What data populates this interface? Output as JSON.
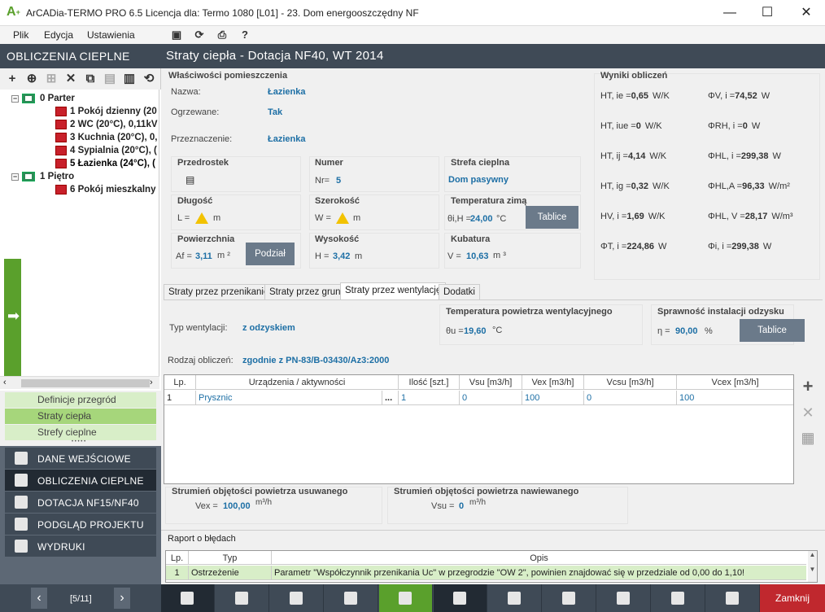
{
  "window": {
    "title": "ArCADia-TERMO PRO 6.5 Licencja dla: Termo 1080 [L01] - 23. Dom energooszczędny NF",
    "min": "—",
    "max": "☐",
    "close": "✕"
  },
  "menu": {
    "file": "Plik",
    "edit": "Edycja",
    "settings": "Ustawienia",
    "help": "?"
  },
  "left": {
    "header": "OBLICZENIA CIEPLNE",
    "tree": [
      {
        "label": "0 Parter",
        "level": 0
      },
      {
        "label": "1 Pokój dzienny (20",
        "level": 1
      },
      {
        "label": "2 WC (20°C), 0,11kV",
        "level": 1
      },
      {
        "label": "3 Kuchnia (20°C), 0,",
        "level": 1
      },
      {
        "label": "4 Sypialnia (20°C), (",
        "level": 1
      },
      {
        "label": "5 Łazienka (24°C), (",
        "level": 1
      },
      {
        "label": "1 Piętro",
        "level": 0
      },
      {
        "label": "6 Pokój mieszkalny",
        "level": 1
      }
    ],
    "sub": [
      "Definicje przegród",
      "Straty ciepła",
      "Strefy cieplne"
    ],
    "subdots": "• • • • •",
    "nav": [
      "DANE WEJŚCIOWE",
      "OBLICZENIA CIEPLNE",
      "DOTACJA NF15/NF40",
      "PODGLĄD PROJEKTU",
      "WYDRUKI"
    ]
  },
  "right": {
    "header": "Straty ciepła - Dotacja NF40, WT 2014",
    "props": {
      "title": "Właściwości pomieszczenia",
      "name_l": "Nazwa:",
      "name_v": "Łazienka",
      "heated_l": "Ogrzewane:",
      "heated_v": "Tak",
      "purpose_l": "Przeznaczenie:",
      "purpose_v": "Łazienka",
      "prefix_l": "Przedrostek",
      "number_l": "Numer",
      "nr_l": "Nr=",
      "nr_v": "5",
      "zone_l": "Strefa cieplna",
      "zone_v": "Dom pasywny",
      "length_l": "Długość",
      "L_l": "L =",
      "unit_m": "m",
      "width_l": "Szerokość",
      "W_l": "W =",
      "temp_l": "Temperatura zimą",
      "theta_l": "θi,H =",
      "theta_v": "24,00",
      "theta_u": "°C",
      "tables_btn": "Tablice",
      "area_l": "Powierzchnia",
      "Af_l": "Af =",
      "Af_v": "3,11",
      "Af_u": "m ²",
      "split_btn": "Podział",
      "height_l": "Wysokość",
      "H_l": "H =",
      "H_v": "3,42",
      "H_u": "m",
      "volume_l": "Kubatura",
      "V_l": "V =",
      "V_v": "10,63",
      "V_u": "m ³"
    },
    "results": {
      "title": "Wyniki obliczeń",
      "items": [
        {
          "k": "HT, ie",
          "v": "0,65",
          "u": "W/K"
        },
        {
          "k": "ΦV, i",
          "v": "74,52",
          "u": "W"
        },
        {
          "k": "HT, iue",
          "v": "0",
          "u": "W/K"
        },
        {
          "k": "ΦRH, i",
          "v": "0",
          "u": "W"
        },
        {
          "k": "HT, ij",
          "v": "4,14",
          "u": "W/K"
        },
        {
          "k": "ΦHL, i",
          "v": "299,38",
          "u": "W"
        },
        {
          "k": "HT, ig",
          "v": "0,32",
          "u": "W/K"
        },
        {
          "k": "ΦHL,A",
          "v": "96,33",
          "u": "W/m²"
        },
        {
          "k": "HV, i",
          "v": "1,69",
          "u": "W/K"
        },
        {
          "k": "ΦHL, V",
          "v": "28,17",
          "u": "W/m³"
        },
        {
          "k": "ΦT, i",
          "v": "224,86",
          "u": "W"
        },
        {
          "k": "Φi, i",
          "v": "299,38",
          "u": "W"
        }
      ]
    },
    "tabs": [
      "Straty przez przenikanie",
      "Straty przez grunt",
      "Straty przez wentylację",
      "Dodatki"
    ],
    "vent": {
      "type_l": "Typ wentylacji:",
      "type_v": "z odzyskiem",
      "temp_title": "Temperatura powietrza wentylacyjnego",
      "theta_l": "θu =",
      "theta_v": "19,60",
      "theta_u": "°C",
      "eff_title": "Sprawność instalacji odzysku",
      "eta_l": "η =",
      "eta_v": "90,00",
      "eta_u": "%",
      "tables_btn": "Tablice",
      "calc_l": "Rodzaj obliczeń:",
      "calc_v": "zgodnie z PN-83/B-03430/Az3:2000"
    },
    "table": {
      "headers": [
        "Lp.",
        "Urządzenia / aktywności",
        "",
        "Ilość [szt.]",
        "Vsu [m3/h]",
        "Vex [m3/h]",
        "Vcsu [m3/h]",
        "Vcex [m3/h]"
      ],
      "rows": [
        [
          "1",
          "Prysznic",
          "...",
          "1",
          "0",
          "100",
          "0",
          "100"
        ]
      ]
    },
    "streams": {
      "out_title": "Strumień objętości powietrza usuwanego",
      "out_l": "Vex =",
      "out_v": "100,00",
      "out_u": "m³/h",
      "in_title": "Strumień objętości powietrza nawiewanego",
      "in_l": "Vsu =",
      "in_v": "0",
      "in_u": "m³/h"
    },
    "errors": {
      "title": "Raport o błędach",
      "headers": [
        "Lp.",
        "Typ",
        "Opis"
      ],
      "rows": [
        [
          "1",
          "Ostrzeżenie",
          "Parametr \"Współczynnik przenikania Uc\" w przegrodzie \"OW 2\", powinien znajdować się w przedziale od 0,00 do 1,10!"
        ]
      ]
    }
  },
  "bottom": {
    "page": "[5/11]",
    "prev": "‹",
    "next": "›",
    "close": "Zamknij"
  }
}
